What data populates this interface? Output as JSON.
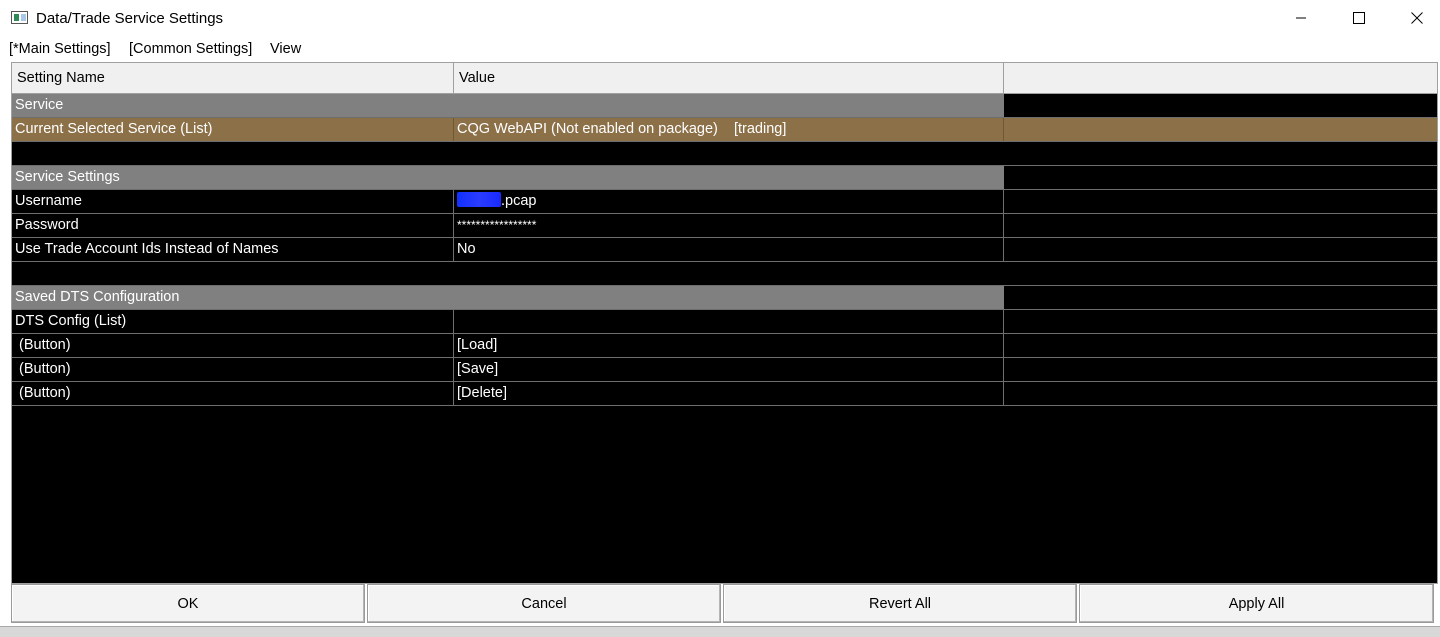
{
  "window": {
    "title": "Data/Trade Service Settings"
  },
  "menu": {
    "items": [
      "[*Main Settings]",
      "[Common Settings]",
      "View"
    ]
  },
  "grid": {
    "headers": {
      "name": "Setting Name",
      "value": "Value",
      "extra": ""
    },
    "rows": [
      {
        "type": "section",
        "name": "Service"
      },
      {
        "type": "selected",
        "name": "Current Selected Service (List)",
        "value": "CQG WebAPI (Not enabled on package)    [trading]"
      },
      {
        "type": "blank"
      },
      {
        "type": "section",
        "name": "Service Settings"
      },
      {
        "type": "item",
        "name": "Username",
        "value": ".pcap",
        "redacted_prefix": true
      },
      {
        "type": "item",
        "name": "Password",
        "value": "*****************"
      },
      {
        "type": "item",
        "name": "Use Trade Account Ids Instead of Names",
        "value": "No"
      },
      {
        "type": "blank"
      },
      {
        "type": "section",
        "name": "Saved DTS Configuration"
      },
      {
        "type": "item",
        "name": "DTS Config (List)",
        "value": ""
      },
      {
        "type": "button",
        "name": "(Button)",
        "value": "[Load]"
      },
      {
        "type": "button",
        "name": "(Button)",
        "value": "[Save]"
      },
      {
        "type": "button",
        "name": "(Button)",
        "value": "[Delete]"
      }
    ]
  },
  "footer": {
    "ok": "OK",
    "cancel": "Cancel",
    "revert": "Revert All",
    "apply": "Apply All"
  },
  "colors": {
    "grid_bg": "#000000",
    "section_bg": "#808080",
    "selected_bg": "#8c7048",
    "redaction": "#1230ff"
  },
  "icons": {
    "app": "app-window-icon",
    "minimize": "minimize-icon",
    "maximize": "maximize-icon",
    "close": "close-icon"
  }
}
